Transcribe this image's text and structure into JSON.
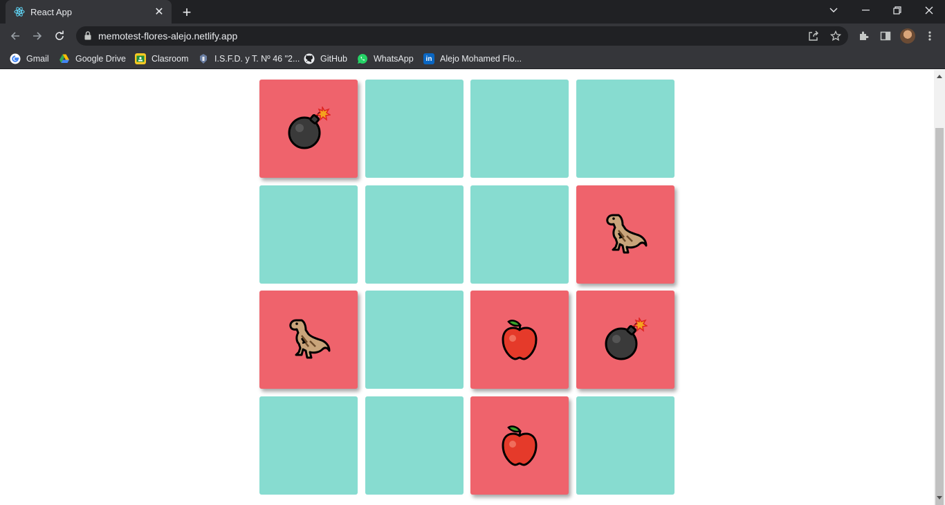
{
  "browser": {
    "tab": {
      "title": "React App",
      "favicon": "react-icon",
      "close_label": "✕"
    },
    "new_tab_label": "+",
    "url": "memotest-flores-alejo.netlify.app",
    "bookmarks": [
      {
        "label": "Gmail",
        "icon": "google-icon"
      },
      {
        "label": "Google Drive",
        "icon": "drive-icon"
      },
      {
        "label": "Clasroom",
        "icon": "classroom-icon"
      },
      {
        "label": "I.S.F.D. y T. Nº 46 \"2...",
        "icon": "institute-icon"
      },
      {
        "label": "GitHub",
        "icon": "github-icon"
      },
      {
        "label": "WhatsApp",
        "icon": "whatsapp-icon"
      },
      {
        "label": "Alejo Mohamed Flo...",
        "icon": "linkedin-icon"
      }
    ]
  },
  "game": {
    "colors": {
      "hidden": "#87dcd0",
      "revealed": "#ef636c"
    },
    "cards": [
      {
        "state": "revealed",
        "emoji": "bomb"
      },
      {
        "state": "hidden",
        "emoji": ""
      },
      {
        "state": "hidden",
        "emoji": ""
      },
      {
        "state": "hidden",
        "emoji": ""
      },
      {
        "state": "hidden",
        "emoji": ""
      },
      {
        "state": "hidden",
        "emoji": ""
      },
      {
        "state": "hidden",
        "emoji": ""
      },
      {
        "state": "revealed",
        "emoji": "dinosaur"
      },
      {
        "state": "revealed",
        "emoji": "dinosaur"
      },
      {
        "state": "hidden",
        "emoji": ""
      },
      {
        "state": "revealed",
        "emoji": "apple"
      },
      {
        "state": "revealed",
        "emoji": "bomb"
      },
      {
        "state": "hidden",
        "emoji": ""
      },
      {
        "state": "hidden",
        "emoji": ""
      },
      {
        "state": "revealed",
        "emoji": "apple"
      },
      {
        "state": "hidden",
        "emoji": ""
      }
    ]
  }
}
